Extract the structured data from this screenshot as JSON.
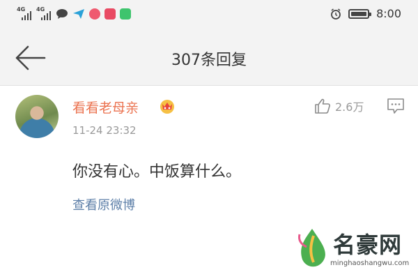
{
  "status_bar": {
    "network_1": "4G",
    "network_2": "4G",
    "time": "8:00",
    "icons": [
      "signal-icon",
      "signal-icon",
      "chat-icon",
      "send-icon",
      "app-icon",
      "app-icon",
      "app-icon",
      "alarm-icon",
      "battery-icon"
    ]
  },
  "nav": {
    "back_icon": "back-arrow-icon",
    "title": "307条回复"
  },
  "comment": {
    "username": "看看老母亲",
    "badge_icon": "vip-crown-icon",
    "timestamp": "11-24 23:32",
    "like_count": "2.6万",
    "text": "你没有心。中饭算什么。",
    "view_original": "查看原微博"
  },
  "watermark": {
    "name": "名豪网",
    "url": "minghaoshangwu.com"
  },
  "colors": {
    "username": "#eb7350",
    "link": "#5d7fa8",
    "meta": "#999999",
    "text": "#333333",
    "bar_bg": "#f3f3f3"
  }
}
